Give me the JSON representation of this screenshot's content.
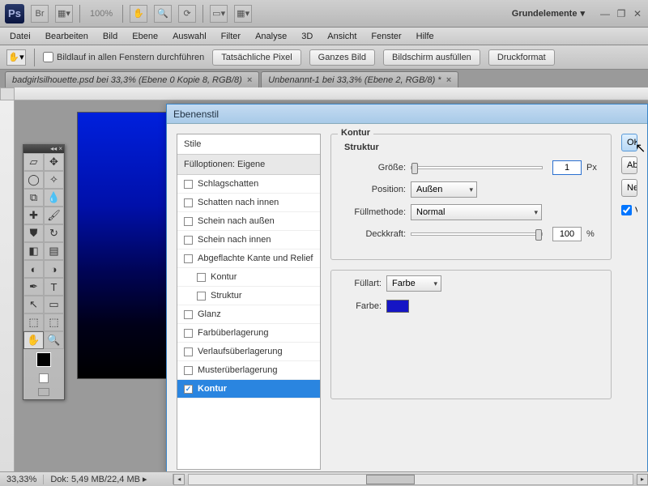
{
  "top": {
    "zoom": "100%",
    "workspace": "Grundelemente"
  },
  "menu": [
    "Datei",
    "Bearbeiten",
    "Bild",
    "Ebene",
    "Auswahl",
    "Filter",
    "Analyse",
    "3D",
    "Ansicht",
    "Fenster",
    "Hilfe"
  ],
  "opts": {
    "scroll_all": "Bildlauf in allen Fenstern durchführen",
    "b1": "Tatsächliche Pixel",
    "b2": "Ganzes Bild",
    "b3": "Bildschirm ausfüllen",
    "b4": "Druckformat"
  },
  "tabs": {
    "t1": "badgirlsilhouette.psd bei 33,3% (Ebene 0 Kopie 8, RGB/8)",
    "t2": "Unbenannt-1 bei 33,3% (Ebene 2, RGB/8) *"
  },
  "dialog": {
    "title": "Ebenenstil",
    "stile": "Stile",
    "fill": "Fülloptionen: Eigene",
    "items": [
      {
        "label": "Schlagschatten",
        "chk": false,
        "indent": false
      },
      {
        "label": "Schatten nach innen",
        "chk": false,
        "indent": false
      },
      {
        "label": "Schein nach außen",
        "chk": false,
        "indent": false
      },
      {
        "label": "Schein nach innen",
        "chk": false,
        "indent": false
      },
      {
        "label": "Abgeflachte Kante und Relief",
        "chk": false,
        "indent": false
      },
      {
        "label": "Kontur",
        "chk": false,
        "indent": true
      },
      {
        "label": "Struktur",
        "chk": false,
        "indent": true
      },
      {
        "label": "Glanz",
        "chk": false,
        "indent": false
      },
      {
        "label": "Farbüberlagerung",
        "chk": false,
        "indent": false
      },
      {
        "label": "Verlaufsüberlagerung",
        "chk": false,
        "indent": false
      },
      {
        "label": "Musterüberlagerung",
        "chk": false,
        "indent": false
      },
      {
        "label": "Kontur",
        "chk": true,
        "indent": false,
        "sel": true
      }
    ],
    "grp_kontur": "Kontur",
    "grp_struktur": "Struktur",
    "size_lbl": "Größe:",
    "size_val": "1",
    "size_unit": "Px",
    "pos_lbl": "Position:",
    "pos_val": "Außen",
    "blend_lbl": "Füllmethode:",
    "blend_val": "Normal",
    "opac_lbl": "Deckkraft:",
    "opac_val": "100",
    "opac_unit": "%",
    "filltype_lbl": "Füllart:",
    "filltype_val": "Farbe",
    "color_lbl": "Farbe:",
    "color_hex": "#1515c5",
    "ok": "OK",
    "cancel": "Abbrechen",
    "new_style": "Neuer Stil...",
    "preview": "Vorschau"
  },
  "status": {
    "zoom": "33,33%",
    "doc": "Dok: 5,49 MB/22,4 MB"
  }
}
